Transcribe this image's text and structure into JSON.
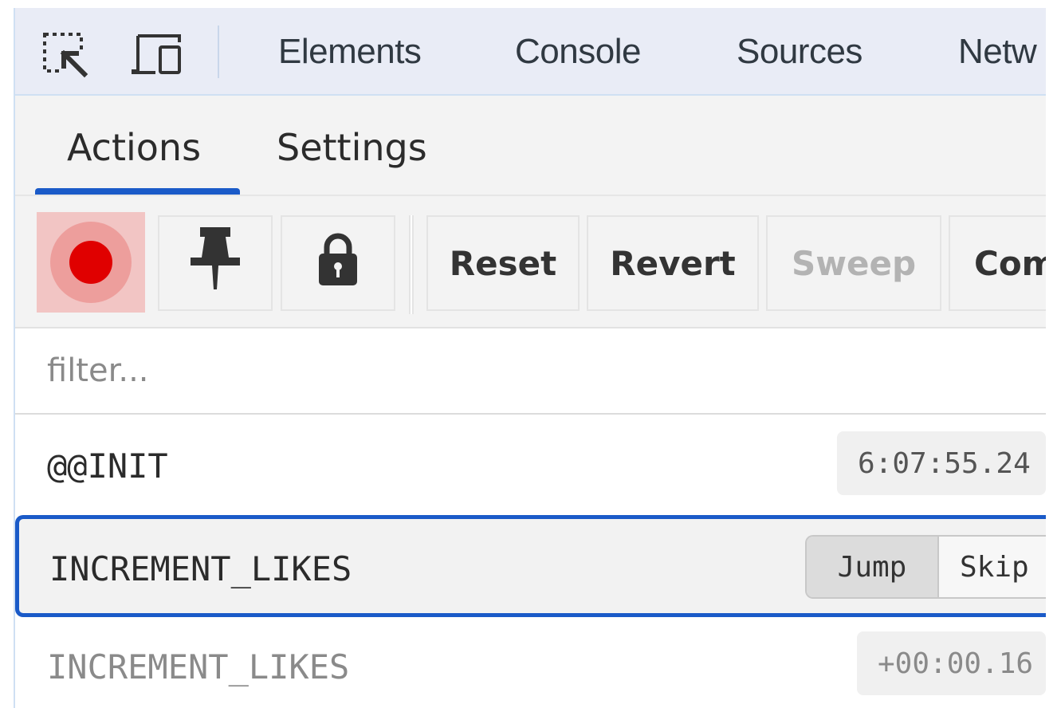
{
  "devtools": {
    "icons": [
      "inspect-element-icon",
      "device-toolbar-icon"
    ],
    "tabs": [
      "Elements",
      "Console",
      "Sources",
      "Netw"
    ]
  },
  "redux": {
    "tabs": [
      "Actions",
      "Settings"
    ],
    "active_tab": "Actions"
  },
  "toolbar": {
    "record_icon": "record-icon",
    "pin_icon": "pin-icon",
    "lock_icon": "lock-icon",
    "buttons": [
      "Reset",
      "Revert",
      "Sweep",
      "Com"
    ],
    "disabled_buttons": [
      "Sweep"
    ],
    "record_color": "#e00000"
  },
  "filter": {
    "placeholder": "filter..."
  },
  "actions": [
    {
      "name": "@@INIT",
      "time": "6:07:55.24"
    },
    {
      "name": "INCREMENT_LIKES",
      "selected": true,
      "jump_label": "Jump",
      "skip_label": "Skip"
    },
    {
      "name": "INCREMENT_LIKES",
      "time": "+00:00.16"
    }
  ],
  "colors": {
    "accent": "#1a5ac8"
  }
}
